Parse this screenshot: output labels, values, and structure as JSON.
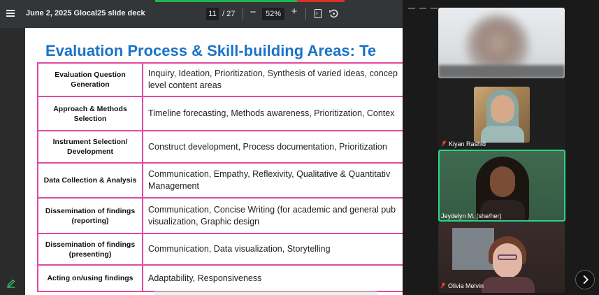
{
  "viewer": {
    "title": "June 2, 2025 Glocal25 slide deck",
    "page_current": "11",
    "page_total": "/ 27",
    "zoom": "52%",
    "zoom_out_label": "−",
    "zoom_in_label": "+"
  },
  "slide": {
    "title": "Evaluation Process & Skill-building Areas: Te",
    "rows": [
      {
        "area": "Evaluation Question Generation",
        "skills": [
          "Inquiry, Ideation, Prioritization, Synthesis of varied ideas, concep",
          "level content areas"
        ]
      },
      {
        "area": "Approach & Methods Selection",
        "skills": [
          "Timeline forecasting, Methods awareness, Prioritization, Contex"
        ]
      },
      {
        "area": "Instrument Selection/ Development",
        "skills": [
          "Construct development, Process documentation, Prioritization"
        ]
      },
      {
        "area": "Data Collection & Analysis",
        "skills": [
          "Communication, Empathy, Reflexivity, Qualitative & Quantitativ",
          "Management"
        ]
      },
      {
        "area": "Dissemination of findings (reporting)",
        "skills": [
          "Communication, Concise Writing (for academic and general pub",
          "visualization, Graphic design"
        ]
      },
      {
        "area": "Dissemination of findings (presenting)",
        "skills": [
          "Communication, Data visualization, Storytelling"
        ]
      },
      {
        "area": "Acting on/using findings",
        "skills": [
          "Adaptability, Responsiveness"
        ]
      }
    ]
  },
  "participants": [
    {
      "name": "",
      "muted": false,
      "speaking": false
    },
    {
      "name": "Kiyan Rashid",
      "muted": true,
      "speaking": false
    },
    {
      "name": "Jeydelyn M. (she/her)",
      "muted": false,
      "speaking": true
    },
    {
      "name": "Olivia Melvin",
      "muted": true,
      "speaking": false
    }
  ],
  "colors": {
    "title_blue": "#1a73c9",
    "table_border": "#e04aa1",
    "speaking_border": "#2fd38a",
    "toolbar_bg": "#323639",
    "mic_muted": "#ea4335"
  }
}
